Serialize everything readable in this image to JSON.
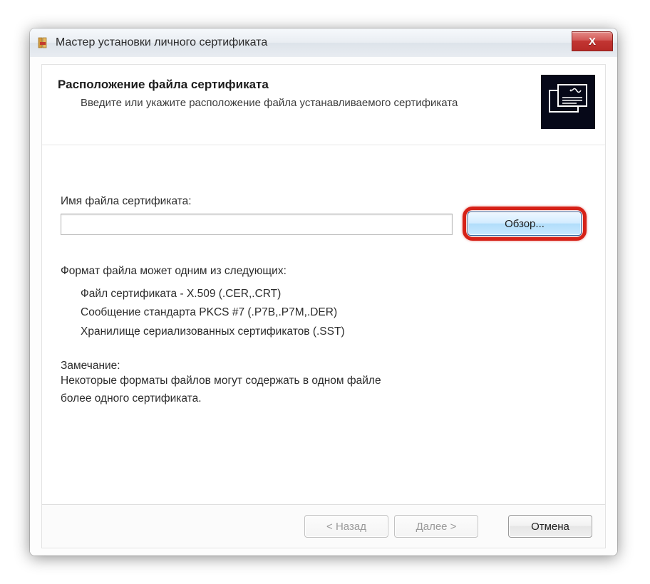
{
  "window": {
    "title": "Мастер установки личного сертификата"
  },
  "header": {
    "title": "Расположение файла сертификата",
    "subtitle": "Введите или укажите расположение файла устанавливаемого сертификата"
  },
  "body": {
    "field_label": "Имя файла сертификата:",
    "field_value": "",
    "browse_label": "Обзор...",
    "format_title": "Формат файла может одним из следующих:",
    "format_items": [
      "Файл сертификата - X.509 (.CER,.CRT)",
      "Сообщение стандарта PKCS #7 (.P7B,.P7M,.DER)",
      "Хранилище сериализованных сертификатов (.SST)"
    ],
    "note_title": "Замечание:",
    "note_text_1": "Некоторые форматы файлов могут содержать в одном файле",
    "note_text_2": "более одного сертификата."
  },
  "footer": {
    "back_label": "< Назад",
    "next_label": "Далее >",
    "cancel_label": "Отмена"
  }
}
